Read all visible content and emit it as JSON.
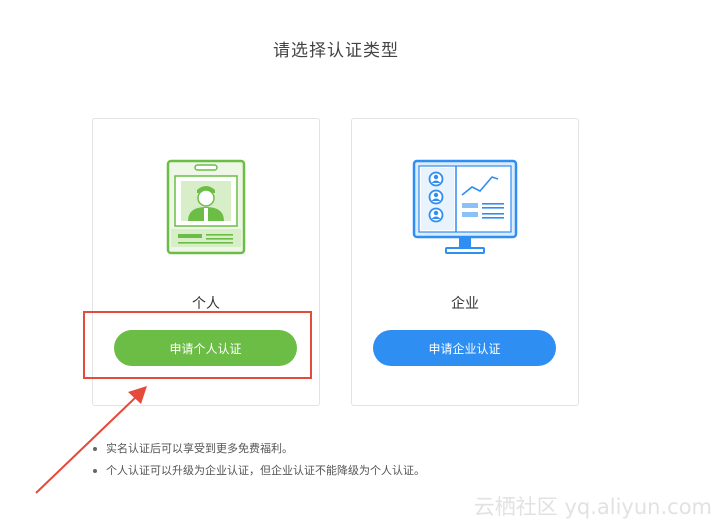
{
  "page": {
    "title": "请选择认证类型"
  },
  "cards": {
    "personal": {
      "label": "个人",
      "button_label": "申请个人认证",
      "illustration_icon": "id-badge-icon"
    },
    "enterprise": {
      "label": "企业",
      "button_label": "申请企业认证",
      "illustration_icon": "monitor-dashboard-icon"
    }
  },
  "notes": [
    "实名认证后可以享受到更多免费福利。",
    "个人认证可以升级为企业认证，但企业认证不能降级为个人认证。"
  ],
  "watermark": "云栖社区 yq.aliyun.com",
  "colors": {
    "personal_accent": "#6cbd45",
    "enterprise_accent": "#2e8ef2",
    "annotation_red": "#e64a3b"
  }
}
